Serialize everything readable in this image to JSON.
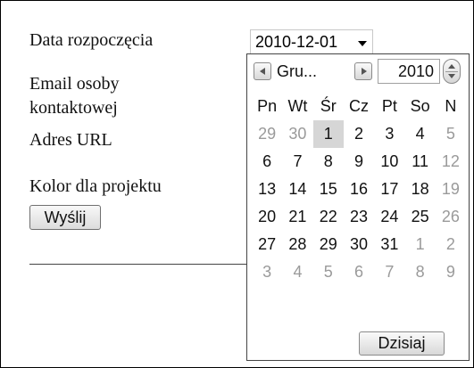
{
  "form": {
    "start_date_label": "Data rozpoczęcia",
    "email_label_line1": "Email osoby",
    "email_label_line2": "kontaktowej",
    "url_label": "Adres URL",
    "color_label": "Kolor dla projektu",
    "submit_label": "Wyślij",
    "date_value": "2010-12-01"
  },
  "calendar": {
    "month_label": "Gru...",
    "year_value": "2010",
    "weekdays": [
      "Pn",
      "Wt",
      "Śr",
      "Cz",
      "Pt",
      "So",
      "N"
    ],
    "weeks": [
      [
        {
          "d": "29",
          "m": true
        },
        {
          "d": "30",
          "m": true
        },
        {
          "d": "1",
          "sel": true
        },
        {
          "d": "2"
        },
        {
          "d": "3"
        },
        {
          "d": "4"
        },
        {
          "d": "5",
          "m": true
        }
      ],
      [
        {
          "d": "6"
        },
        {
          "d": "7"
        },
        {
          "d": "8"
        },
        {
          "d": "9"
        },
        {
          "d": "10"
        },
        {
          "d": "11"
        },
        {
          "d": "12",
          "m": true
        }
      ],
      [
        {
          "d": "13"
        },
        {
          "d": "14"
        },
        {
          "d": "15"
        },
        {
          "d": "16"
        },
        {
          "d": "17"
        },
        {
          "d": "18"
        },
        {
          "d": "19",
          "m": true
        }
      ],
      [
        {
          "d": "20"
        },
        {
          "d": "21"
        },
        {
          "d": "22"
        },
        {
          "d": "23"
        },
        {
          "d": "24"
        },
        {
          "d": "25"
        },
        {
          "d": "26",
          "m": true
        }
      ],
      [
        {
          "d": "27"
        },
        {
          "d": "28"
        },
        {
          "d": "29"
        },
        {
          "d": "30"
        },
        {
          "d": "31"
        },
        {
          "d": "1",
          "m": true
        },
        {
          "d": "2",
          "m": true
        }
      ],
      [
        {
          "d": "3",
          "m": true
        },
        {
          "d": "4",
          "m": true
        },
        {
          "d": "5",
          "m": true
        },
        {
          "d": "6",
          "m": true
        },
        {
          "d": "7",
          "m": true
        },
        {
          "d": "8",
          "m": true
        },
        {
          "d": "9",
          "m": true
        }
      ]
    ],
    "today_label": "Dzisiaj"
  },
  "icons": {
    "prev": "chevron-left-icon",
    "next": "chevron-right-icon",
    "spin": "spin-updown-icon",
    "dropdown": "caret-down-icon"
  },
  "colors": {
    "selected_day_bg": "#d6d6d6",
    "muted_day": "#9a9a9a"
  }
}
